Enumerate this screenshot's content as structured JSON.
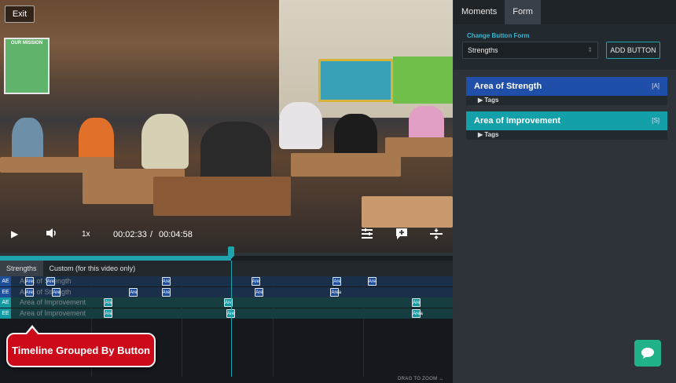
{
  "video": {
    "exit_label": "Exit",
    "poster_text": "OUR MISSION",
    "speed": "1x",
    "current_time": "00:02:33",
    "separator": "/",
    "total_time": "00:04:58",
    "progress_fraction": 0.511
  },
  "timeline": {
    "tabs": [
      "Strengths",
      "Custom (for this video only)"
    ],
    "rows": [
      {
        "tag": "AE",
        "label": "Area of Strength",
        "color": "#1f4f9a",
        "rowbg": "#1a2f4a",
        "markers": [
          {
            "t": 0.055,
            "text": "Are"
          },
          {
            "t": 0.102,
            "text": "Are"
          },
          {
            "t": 0.357,
            "text": "Are"
          },
          {
            "t": 0.555,
            "text": "Are"
          },
          {
            "t": 0.735,
            "text": "Are"
          },
          {
            "t": 0.812,
            "text": "Are"
          }
        ]
      },
      {
        "tag": "EE",
        "label": "Area of Strength",
        "color": "#1f4f9a",
        "rowbg": "#1a2f4a",
        "markers": [
          {
            "t": 0.055,
            "text": "Are"
          },
          {
            "t": 0.115,
            "text": "Are"
          },
          {
            "t": 0.285,
            "text": "Are"
          },
          {
            "t": 0.357,
            "text": "Are"
          },
          {
            "t": 0.563,
            "text": "Are"
          },
          {
            "t": 0.73,
            "text": "Area"
          }
        ]
      },
      {
        "tag": "AE",
        "label": "Area of Improvement",
        "color": "#149aa2",
        "rowbg": "#163d3f",
        "markers": [
          {
            "t": 0.23,
            "text": "Are"
          },
          {
            "t": 0.495,
            "text": "Are"
          },
          {
            "t": 0.91,
            "text": "Are"
          }
        ]
      },
      {
        "tag": "EE",
        "label": "Area of Improvement",
        "color": "#149aa2",
        "rowbg": "#163d3f",
        "markers": [
          {
            "t": 0.23,
            "text": "Are"
          },
          {
            "t": 0.5,
            "text": "Are"
          },
          {
            "t": 0.91,
            "text": "Area"
          }
        ]
      }
    ],
    "drag_hint": "DRAG TO ZOOM"
  },
  "callout": {
    "text": "Timeline Grouped By Button"
  },
  "panel": {
    "tabs": [
      "Moments",
      "Form"
    ],
    "change_form_label": "Change Button Form",
    "form_select_value": "Strengths",
    "add_button_label": "ADD BUTTON",
    "groups": [
      {
        "title": "Area of Strength",
        "key": "[A]",
        "tags_label": "Tags",
        "color": "#1f4fa8"
      },
      {
        "title": "Area of Improvement",
        "key": "[S]",
        "tags_label": "Tags",
        "color": "#14a0a8"
      }
    ]
  }
}
